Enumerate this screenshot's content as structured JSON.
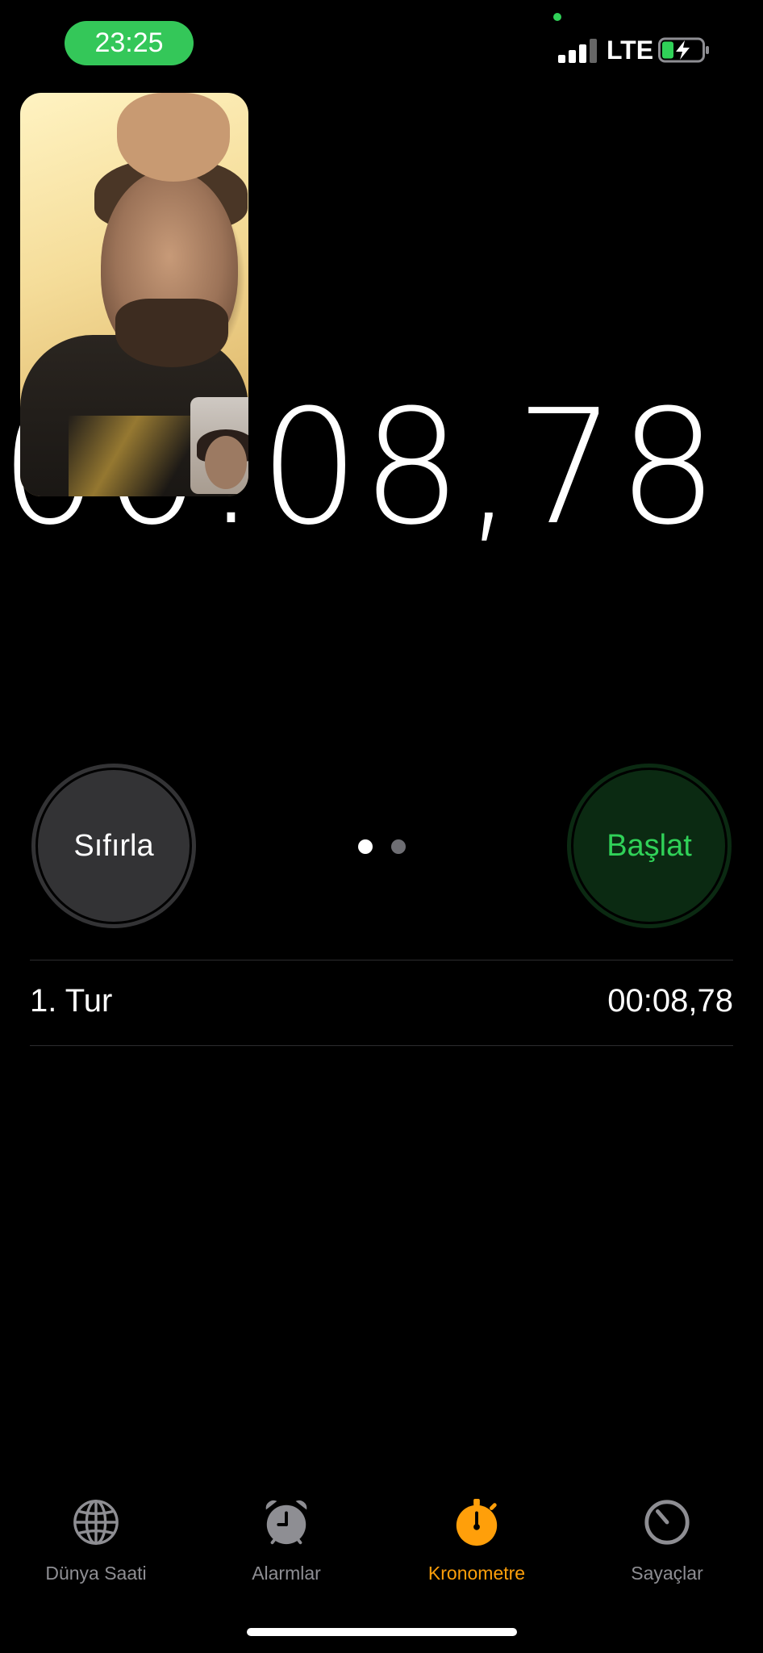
{
  "status_bar": {
    "time": "23:25",
    "network": "LTE"
  },
  "stopwatch": {
    "display": "00:08,78",
    "reset_label": "Sıfırla",
    "start_label": "Başlat",
    "page_count": 2,
    "current_page": 1
  },
  "laps": [
    {
      "label": "1. Tur",
      "time": "00:08,78"
    }
  ],
  "tab_bar": {
    "items": [
      {
        "label": "Dünya Saati",
        "icon": "globe-icon",
        "active": false
      },
      {
        "label": "Alarmlar",
        "icon": "alarm-clock-icon",
        "active": false
      },
      {
        "label": "Kronometre",
        "icon": "stopwatch-icon",
        "active": true
      },
      {
        "label": "Sayaçlar",
        "icon": "timer-icon",
        "active": false
      }
    ]
  },
  "colors": {
    "accent": "#FF9F0A",
    "start_green": "#30D158",
    "time_pill": "#34C759",
    "inactive_tab": "#8e8e93"
  }
}
